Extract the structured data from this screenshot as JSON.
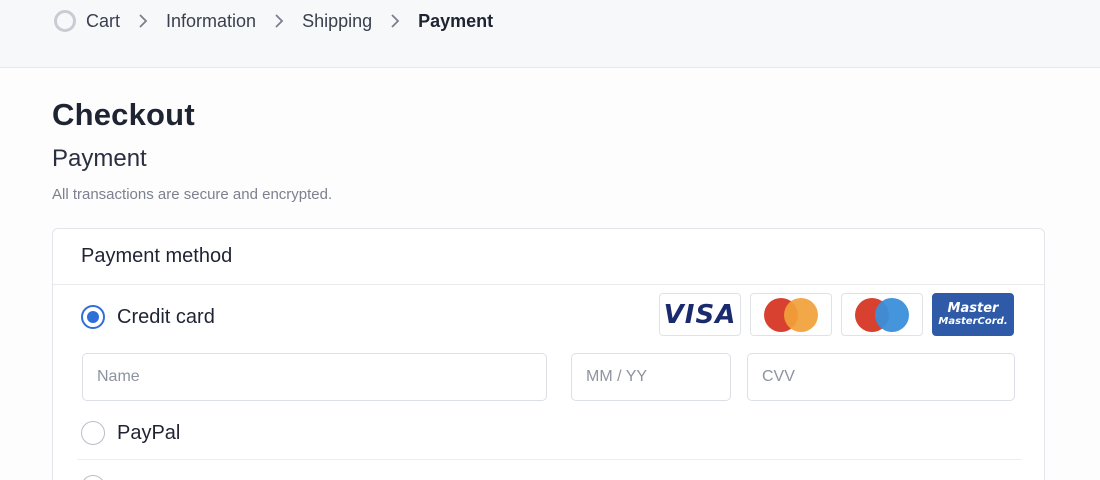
{
  "breadcrumb": {
    "items": [
      {
        "label": "Cart",
        "active": false
      },
      {
        "label": "Information",
        "active": false
      },
      {
        "label": "Shipping",
        "active": false
      },
      {
        "label": "Payment",
        "active": true
      }
    ]
  },
  "page": {
    "title": "Checkout",
    "section": "Payment",
    "note": "All transactions are secure and encrypted."
  },
  "payment": {
    "header": "Payment method",
    "options": [
      {
        "label": "Credit card",
        "selected": true
      },
      {
        "label": "PayPal",
        "selected": false
      }
    ],
    "brands": {
      "visa": "VISA",
      "blue_line1": "Master",
      "blue_line2": "MasterCord."
    },
    "fields": {
      "name_placeholder": "Name",
      "expiry_placeholder": "MM / YY",
      "cvv_placeholder": "CVV"
    }
  },
  "colors": {
    "accent": "#2f6ed8",
    "mastercard_red": "#d8412f",
    "mastercard_orange": "#f1a13a",
    "maestro_blue": "#3a8fd9",
    "brand_blue": "#2e5aa7"
  }
}
